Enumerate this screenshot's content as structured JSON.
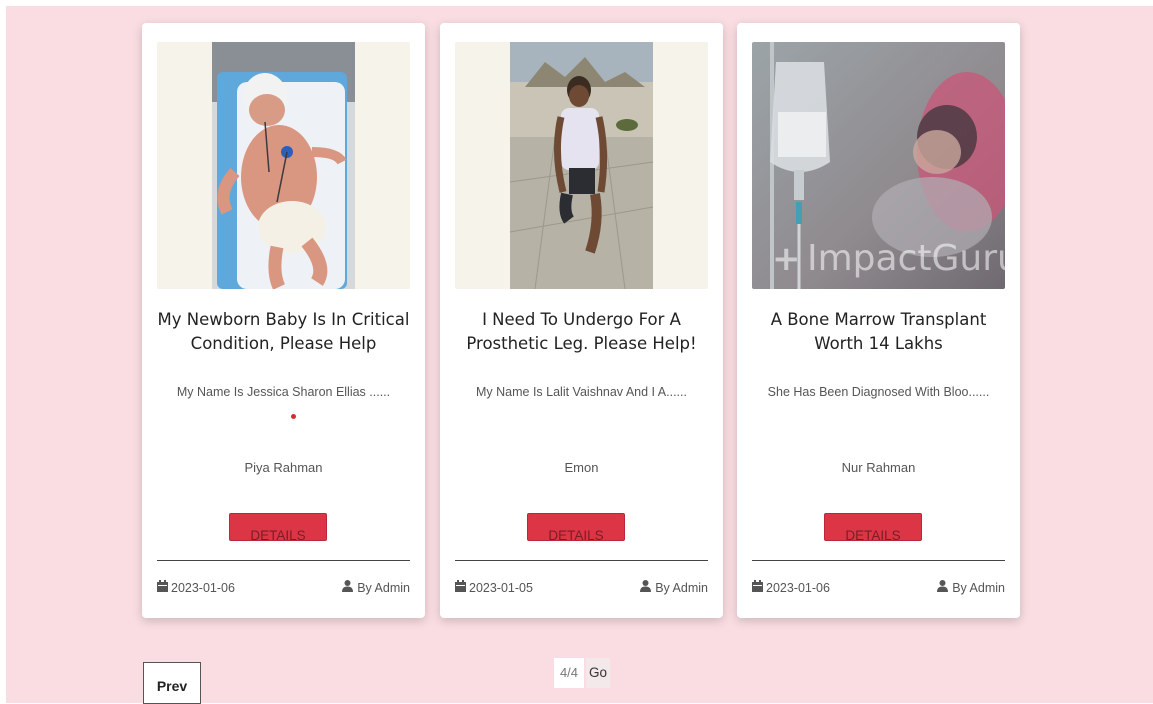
{
  "colors": {
    "background": "#f9dde2",
    "accent": "#dc3545",
    "card": "#ffffff"
  },
  "cards": [
    {
      "title": "My Newborn Baby Is In Critical Condition, Please Help",
      "excerpt": "My Name Is Jessica Sharon Ellias ......",
      "author": "Piya Rahman",
      "button": "DETAILS",
      "date": "2023-01-06",
      "by": "By Admin",
      "date_icon": "calendar-icon",
      "by_icon": "user-icon"
    },
    {
      "title": "I Need To Undergo For A Prosthetic Leg. Please Help!",
      "excerpt": "My Name Is Lalit Vaishnav And I A......",
      "author": "Emon",
      "button": "DETAILS",
      "date": "2023-01-05",
      "by": "By Admin",
      "date_icon": "calendar-icon",
      "by_icon": "user-icon"
    },
    {
      "title": "A Bone Marrow Transplant Worth 14 Lakhs",
      "excerpt": "She Has Been Diagnosed With Bloo......",
      "author": "Nur Rahman",
      "button": "DETAILS",
      "date": "2023-01-06",
      "by": "By Admin",
      "date_icon": "calendar-icon",
      "by_icon": "user-icon",
      "photo_watermark": "ImpactGuru"
    }
  ],
  "pagination": {
    "prev": "Prev",
    "indicator": "4/4",
    "go": "Go"
  }
}
